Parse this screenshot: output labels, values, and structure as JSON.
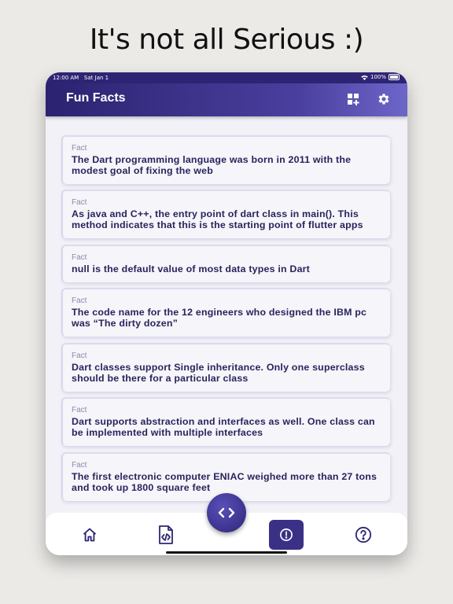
{
  "headline": "It's not all Serious :)",
  "status_bar": {
    "time": "12:00 AM",
    "date": "Sat Jan 1",
    "battery": "100%"
  },
  "app_bar": {
    "title": "Fun Facts"
  },
  "facts": [
    {
      "label": "Fact",
      "text": "The Dart programming language was born in 2011 with the modest goal of fixing the web"
    },
    {
      "label": "Fact",
      "text": "As java and C++, the entry point of dart class in main(). This method indicates that this is the starting point of flutter apps"
    },
    {
      "label": "Fact",
      "text": "null is the default value of most data types in Dart"
    },
    {
      "label": "Fact",
      "text": "The code name for the 12 engineers who designed the IBM pc was “The dirty dozen”"
    },
    {
      "label": "Fact",
      "text": "Dart classes support Single inheritance. Only one superclass should be there for a particular class"
    },
    {
      "label": "Fact",
      "text": "Dart supports abstraction and interfaces as well. One class can be implemented with multiple interfaces"
    },
    {
      "label": "Fact",
      "text": "The first electronic computer ENIAC weighed more than 27 tons and took up 1800 square feet"
    }
  ],
  "icons": {
    "appbar": [
      "dashboard-add-icon",
      "gear-icon"
    ],
    "nav": [
      "home-icon",
      "code-file-icon",
      "code-icon",
      "info-icon",
      "help-icon"
    ]
  },
  "colors": {
    "primary": "#2d2574",
    "accent": "#6d66c9",
    "fact_text": "#29245c",
    "label": "#8d8aa8"
  }
}
